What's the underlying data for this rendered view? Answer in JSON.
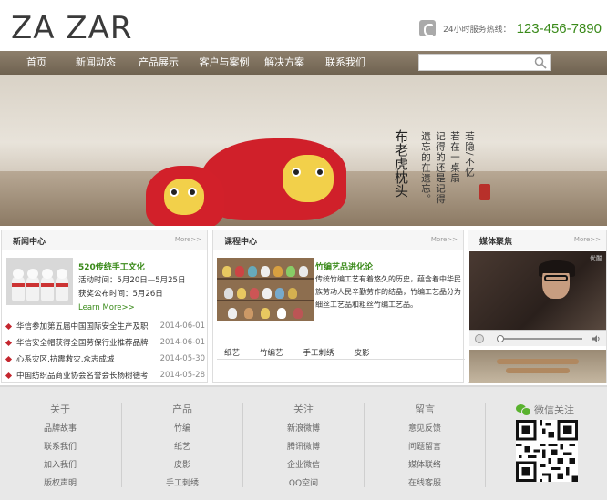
{
  "brand": {
    "logo_text": "ZA ZAR"
  },
  "header": {
    "hotline_label": "24小时服务热线：",
    "hotline_number": "123-456-7890"
  },
  "nav": {
    "items": [
      "首页",
      "新闻动态",
      "产品展示",
      "客户与案例",
      "解决方案",
      "联系我们"
    ],
    "search_placeholder": "",
    "search_value": ""
  },
  "banner": {
    "title": "布老虎枕头",
    "poem": [
      "若隐/不忆",
      "若在一桌扇",
      "记得的还是记得",
      "遗忘的在遗忘。"
    ]
  },
  "news": {
    "title": "新闻中心",
    "more": "More>>",
    "feature_title": "520传统手工文化",
    "feature_line1": "活动时间：5月20日—5月25日",
    "feature_line2": "获奖公布时间：5月26日",
    "learn_more": "Learn More>>",
    "items": [
      {
        "text": "华信参加第五届中国国际安全生产及职",
        "date": "2014-06-01"
      },
      {
        "text": "华信安全帽获得全国劳保行业推荐品牌",
        "date": "2014-06-01"
      },
      {
        "text": "心系灾区,抗震救灾,众志成城",
        "date": "2014-05-30"
      },
      {
        "text": "中国纺织品商业协会名誉会长杨树德考",
        "date": "2014-05-28"
      }
    ]
  },
  "course": {
    "title": "课程中心",
    "more": "More>>",
    "feature_title": "竹编艺品进化论",
    "description": "传统竹编工艺有着悠久的历史，蕴含着中华民族劳动人民辛勤劳作的结晶，竹编工艺品分为细丝工艺品和粗丝竹编工艺品。",
    "tabs": [
      "纸艺",
      "竹编艺",
      "手工刺绣",
      "皮影"
    ]
  },
  "media": {
    "title": "媒体聚焦",
    "more": "More>>",
    "video_logo": "优酷"
  },
  "footer": {
    "columns": [
      {
        "title": "关于",
        "links": [
          "品牌故事",
          "联系我们",
          "加入我们",
          "版权声明"
        ]
      },
      {
        "title": "产品",
        "links": [
          "竹编",
          "纸艺",
          "皮影",
          "手工刺绣"
        ]
      },
      {
        "title": "关注",
        "links": [
          "新浪微博",
          "腾讯微博",
          "企业微信",
          "QQ空间"
        ]
      },
      {
        "title": "留言",
        "links": [
          "意见反馈",
          "问题留言",
          "媒体联络",
          "在线客服"
        ]
      }
    ],
    "wechat_label": "微信关注"
  },
  "colors": {
    "accent_green": "#3a8a1a",
    "nav_brown": "#7d6f5d",
    "bullet_red": "#c4262e"
  }
}
